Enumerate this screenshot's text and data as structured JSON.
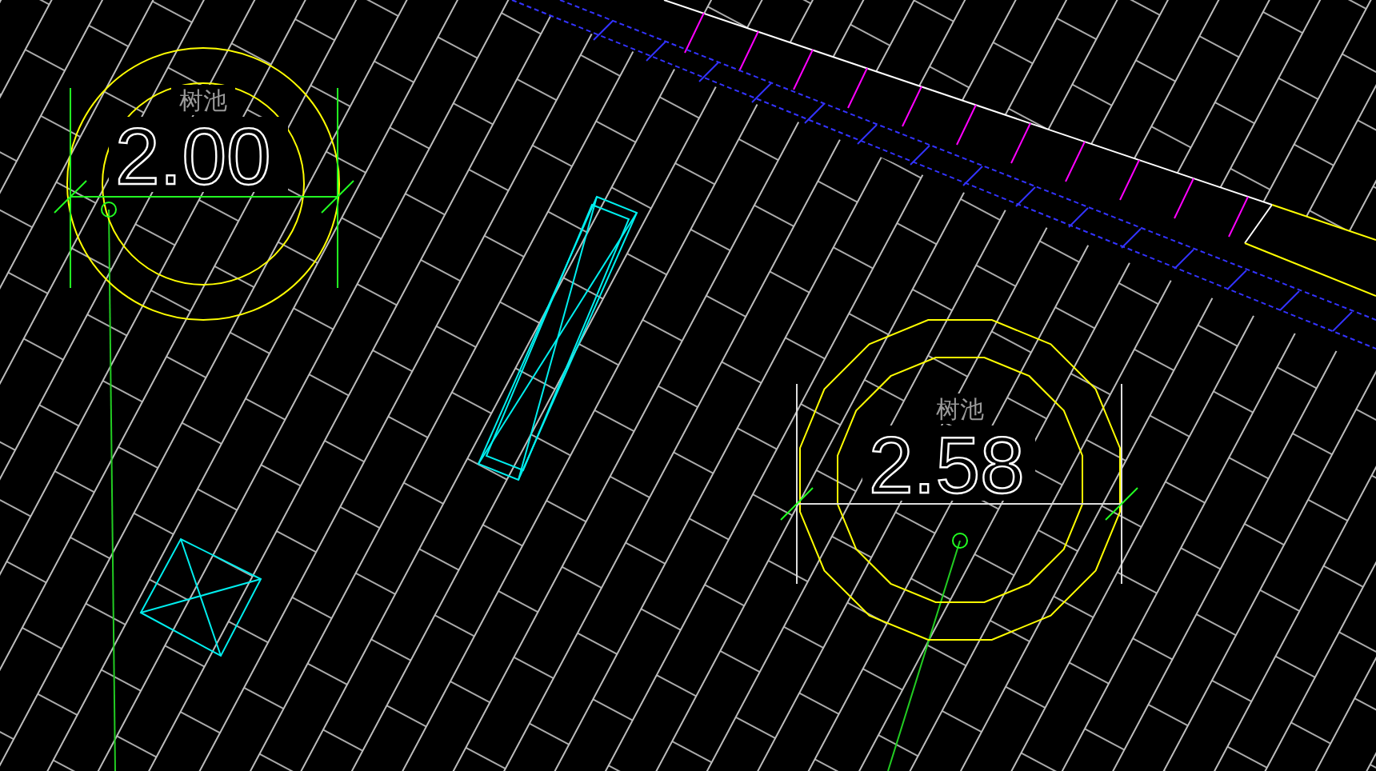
{
  "tree_pits": [
    {
      "kind": "circle",
      "value": "2.00",
      "label": "树池"
    },
    {
      "kind": "polygon",
      "value": "2.58",
      "label": "树池"
    }
  ]
}
